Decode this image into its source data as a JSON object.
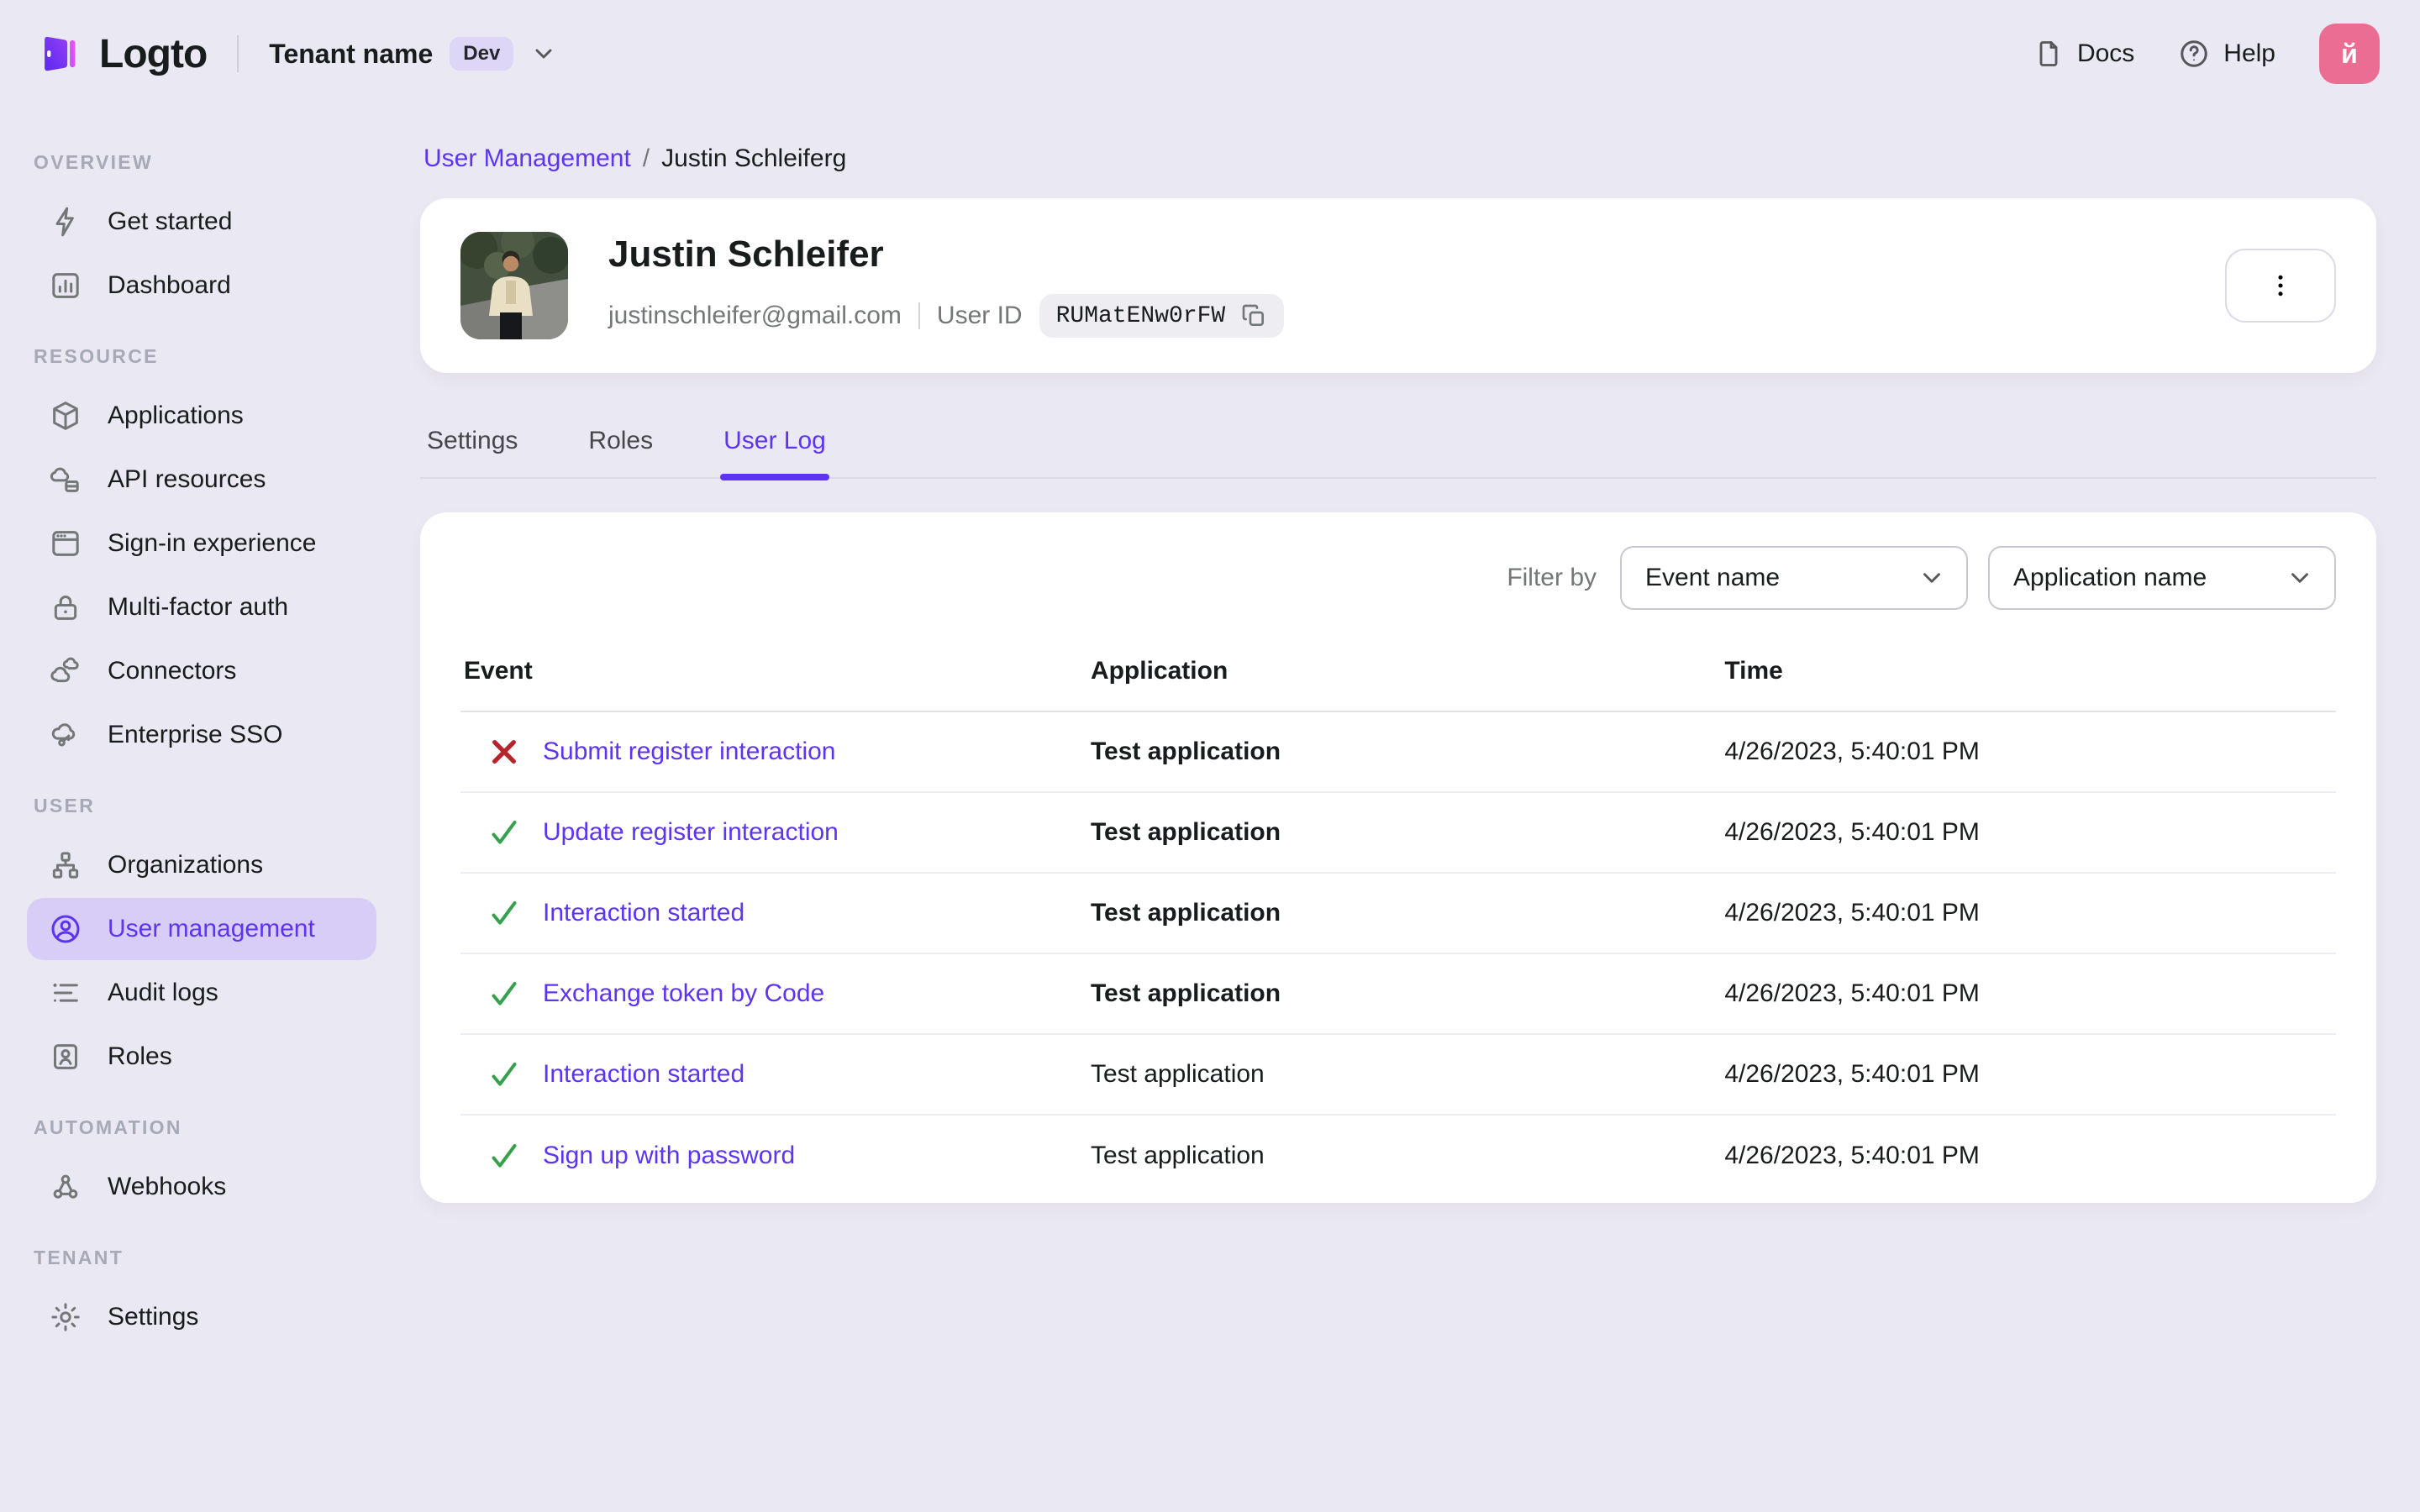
{
  "topbar": {
    "logo_text": "Logto",
    "tenant_name": "Tenant name",
    "tenant_env_badge": "Dev",
    "docs_label": "Docs",
    "help_label": "Help",
    "avatar_letter": "й"
  },
  "sidebar": {
    "sections": [
      {
        "header": "OVERVIEW",
        "items": [
          {
            "label": "Get started"
          },
          {
            "label": "Dashboard"
          }
        ]
      },
      {
        "header": "RESOURCE",
        "items": [
          {
            "label": "Applications"
          },
          {
            "label": "API resources"
          },
          {
            "label": "Sign-in experience"
          },
          {
            "label": "Multi-factor auth"
          },
          {
            "label": "Connectors"
          },
          {
            "label": "Enterprise SSO"
          }
        ]
      },
      {
        "header": "USER",
        "items": [
          {
            "label": "Organizations"
          },
          {
            "label": "User management",
            "active": true
          },
          {
            "label": "Audit logs"
          },
          {
            "label": "Roles"
          }
        ]
      },
      {
        "header": "AUTOMATION",
        "items": [
          {
            "label": "Webhooks"
          }
        ]
      },
      {
        "header": "TENANT",
        "items": [
          {
            "label": "Settings"
          }
        ]
      }
    ]
  },
  "breadcrumb": {
    "parent": "User Management",
    "separator": "/",
    "current": "Justin Schleiferg"
  },
  "user_card": {
    "name": "Justin Schleifer",
    "email": "justinschleifer@gmail.com",
    "user_id_label": "User ID",
    "user_id_value": "RUMatENw0rFW"
  },
  "tabs": [
    {
      "label": "Settings"
    },
    {
      "label": "Roles"
    },
    {
      "label": "User Log",
      "active": true
    }
  ],
  "log_panel": {
    "filter_by_label": "Filter by",
    "filters": [
      {
        "value": "Event name"
      },
      {
        "value": "Application name"
      }
    ],
    "table": {
      "columns": [
        "Event",
        "Application",
        "Time"
      ],
      "rows": [
        {
          "status": "error",
          "event": "Submit register interaction",
          "application": "Test application",
          "time": "4/26/2023, 5:40:01 PM"
        },
        {
          "status": "success",
          "event": "Update register interaction",
          "application": "Test application",
          "time": "4/26/2023, 5:40:01 PM"
        },
        {
          "status": "success",
          "event": "Interaction started",
          "application": "Test application",
          "time": "4/26/2023, 5:40:01 PM"
        },
        {
          "status": "success",
          "event": "Exchange token by Code",
          "application": "Test application",
          "time": "4/26/2023, 5:40:01 PM"
        },
        {
          "status": "success",
          "event": "Interaction started",
          "application": "Test application",
          "time": "4/26/2023, 5:40:01 PM"
        },
        {
          "status": "success",
          "event": "Sign up with password",
          "application": "Test application",
          "time": "4/26/2023, 5:40:01 PM"
        }
      ]
    }
  },
  "colors": {
    "accent_purple": "#5d34f2",
    "active_pill": "#d8cdf6",
    "page_background": "#eae8f2",
    "success_green": "#35a24b",
    "error_red": "#b7252c",
    "avatar_pink": "#ec6d93",
    "badge_background": "#ded6f6"
  }
}
